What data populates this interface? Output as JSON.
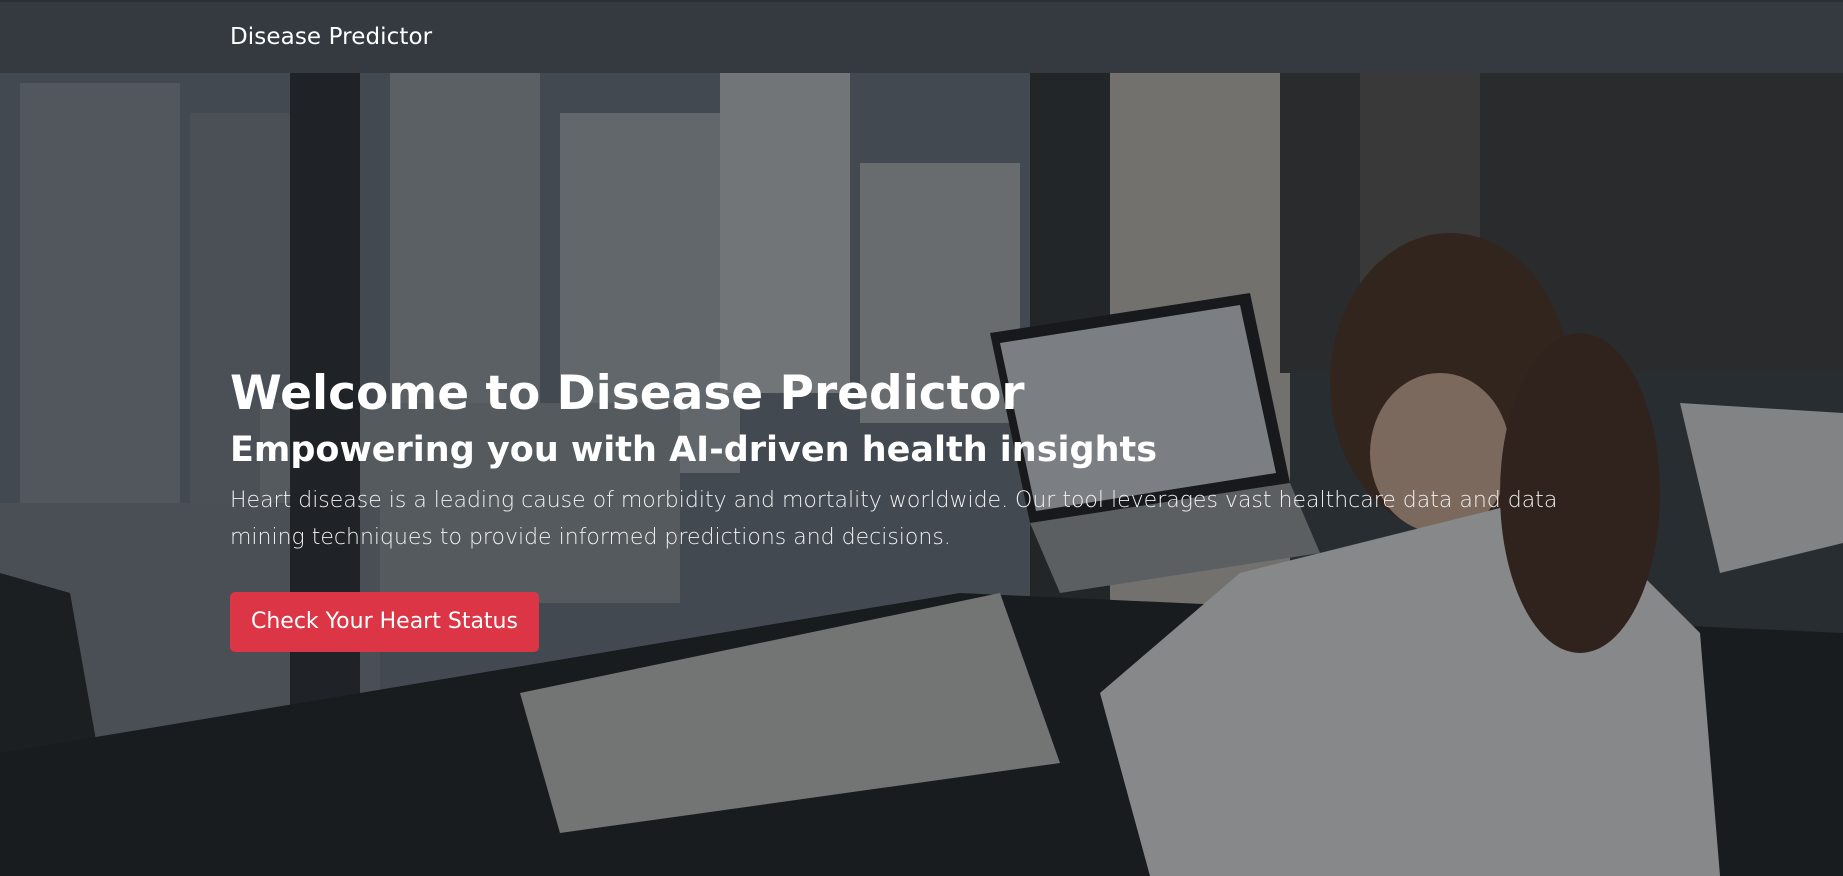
{
  "navbar": {
    "brand": "Disease Predictor",
    "background": "#343a40"
  },
  "hero": {
    "title": "Welcome to Disease Predictor",
    "subtitle": "Empowering you with AI-driven health insights",
    "description": "Heart disease is a leading cause of morbidity and mortality worldwide. Our tool leverages vast healthcare data and data mining techniques to provide informed predictions and decisions.",
    "cta_label": "Check Your Heart Status",
    "cta_color": "#dc3545"
  }
}
